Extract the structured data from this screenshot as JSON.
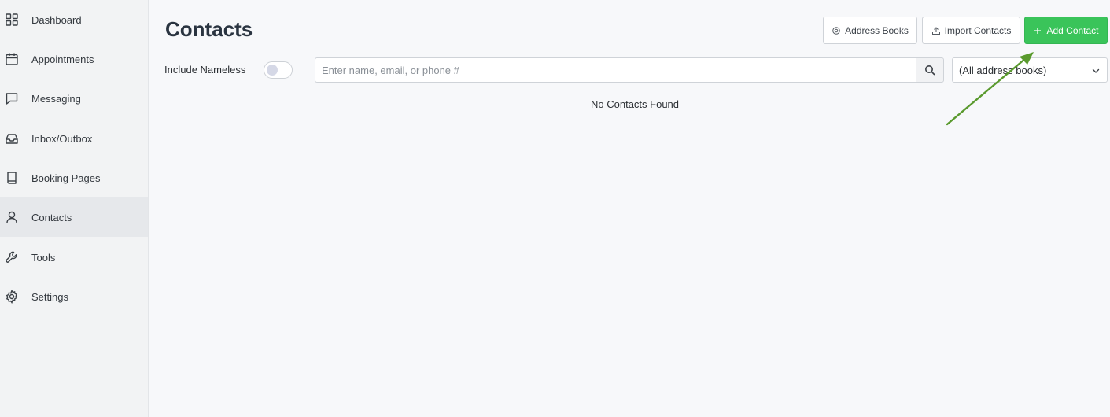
{
  "sidebar": {
    "items": [
      {
        "label": "Dashboard",
        "icon": "grid-icon",
        "active": false
      },
      {
        "label": "Appointments",
        "icon": "calendar-icon",
        "active": false
      },
      {
        "label": "Messaging",
        "icon": "chat-icon",
        "active": false
      },
      {
        "label": "Inbox/Outbox",
        "icon": "inbox-icon",
        "active": false
      },
      {
        "label": "Booking Pages",
        "icon": "book-icon",
        "active": false
      },
      {
        "label": "Contacts",
        "icon": "person-icon",
        "active": true
      },
      {
        "label": "Tools",
        "icon": "wrench-icon",
        "active": false
      },
      {
        "label": "Settings",
        "icon": "gear-icon",
        "active": false
      }
    ]
  },
  "header": {
    "title": "Contacts",
    "buttons": {
      "address_books": "Address Books",
      "import_contacts": "Import Contacts",
      "add_contact": "Add Contact"
    }
  },
  "filters": {
    "include_nameless_label": "Include Nameless",
    "include_nameless_on": false,
    "search_placeholder": "Enter name, email, or phone #",
    "search_value": "",
    "address_book_selected": "(All address books)"
  },
  "results": {
    "empty_message": "No Contacts Found"
  },
  "colors": {
    "accent_green": "#3ac45a",
    "annotation_arrow": "#5a9a2e",
    "sidebar_bg": "#f2f3f4",
    "active_item_bg": "#e6e8eb"
  }
}
